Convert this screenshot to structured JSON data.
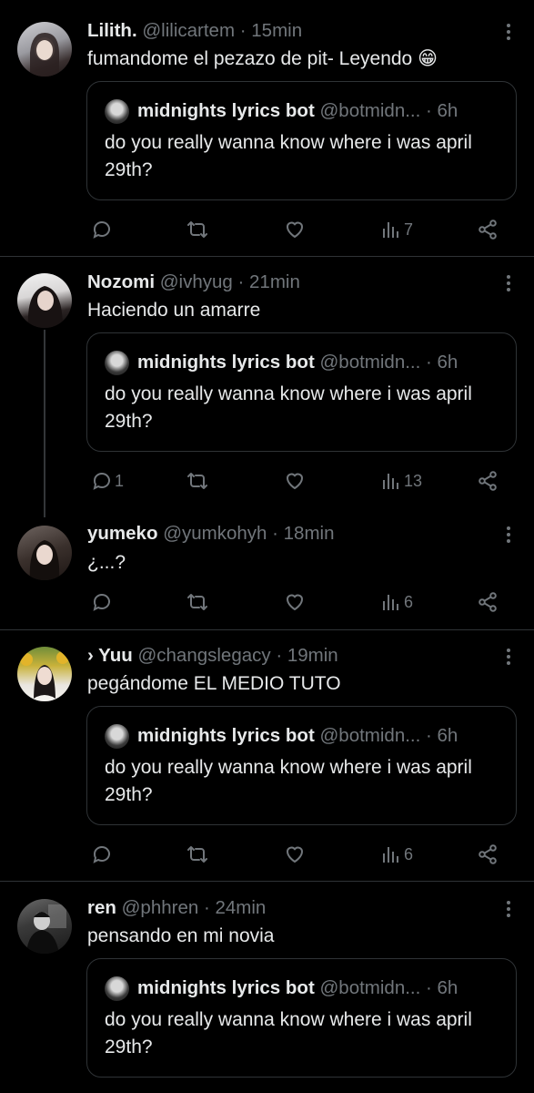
{
  "tweets": [
    {
      "name": "Lilith.",
      "handle": "@lilicartem",
      "time": "15min",
      "text": "fumandome el pezazo de pit- Leyendo 😁",
      "quote": {
        "name": "midnights lyrics bot",
        "handle": "@botmidn...",
        "time": "6h",
        "text": "do you really wanna know where i was april 29th?"
      },
      "replies": "",
      "views": "7"
    },
    {
      "name": "Nozomi",
      "handle": "@ivhyug",
      "time": "21min",
      "text": "Haciendo un amarre",
      "quote": {
        "name": "midnights lyrics bot",
        "handle": "@botmidn...",
        "time": "6h",
        "text": "do you really wanna know where i was april 29th?"
      },
      "replies": "1",
      "views": "13"
    },
    {
      "name": "yumeko",
      "handle": "@yumkohyh",
      "time": "18min",
      "text": "¿...?",
      "replies": "",
      "views": "6"
    },
    {
      "name": "› Yuu",
      "handle": "@changslegacy",
      "time": "19min",
      "text": "pegándome EL MEDIO TUTO",
      "quote": {
        "name": "midnights lyrics bot",
        "handle": "@botmidn...",
        "time": "6h",
        "text": "do you really wanna know where i was april 29th?"
      },
      "replies": "",
      "views": "6"
    },
    {
      "name": "ren",
      "handle": "@phhren",
      "time": "24min",
      "text": "pensando en mi novia",
      "quote": {
        "name": "midnights lyrics bot",
        "handle": "@botmidn...",
        "time": "6h",
        "text": "do you really wanna know where i was april 29th?"
      }
    }
  ],
  "separator": " · ",
  "icons": [
    "more-icon",
    "reply-icon",
    "retweet-icon",
    "like-icon",
    "views-icon",
    "share-icon"
  ],
  "colors": {
    "background": "#000000",
    "text": "#e7e9ea",
    "muted": "#71767b",
    "border": "#2f3336"
  }
}
